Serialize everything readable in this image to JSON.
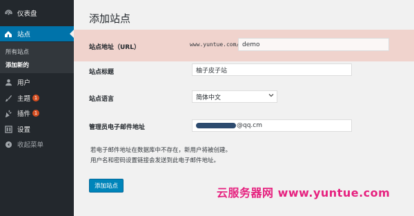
{
  "sidebar": {
    "dashboard": "仪表盘",
    "sites": "站点",
    "sub_all_sites": "所有站点",
    "sub_add_new": "添加新的",
    "users": "用户",
    "themes": "主题",
    "themes_badge": "1",
    "plugins": "插件",
    "plugins_badge": "1",
    "settings": "设置",
    "collapse": "收起菜单"
  },
  "main": {
    "title": "添加站点",
    "site_address_label": "站点地址（URL）",
    "url_prefix": "www.yuntue.com/",
    "url_value": "demo",
    "site_title_label": "站点标题",
    "site_title_value": "柚子皮子站",
    "site_language_label": "站点语言",
    "site_language_value": "简体中文",
    "admin_email_label": "管理员电子邮件地址",
    "admin_email_suffix": "@qq.cm",
    "note_line1": "若电子邮件地址在数据库中不存在，新用户将被创建。",
    "note_line2": "用户名和密码设置链接会发送到此电子邮件地址。",
    "submit_button": "添加站点"
  },
  "watermark": "云服务器网 www.yuntue.com",
  "colors": {
    "sidebar_bg": "#23282d",
    "active_blue": "#0073aa",
    "highlight_row": "#f0d3cd",
    "button_blue": "#0085ba",
    "badge_orange": "#d54e21",
    "watermark_pink": "#e6217f"
  }
}
